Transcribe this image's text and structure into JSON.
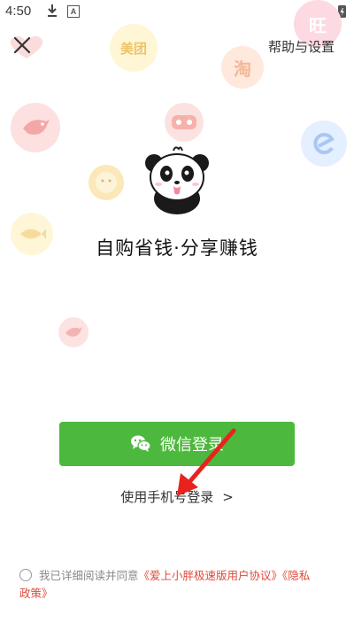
{
  "status_bar": {
    "time": "4:50",
    "a_icon_letter": "A"
  },
  "header": {
    "close_icon": "close-icon",
    "help_label": "帮助与设置"
  },
  "decor": {
    "meituan": "美团",
    "tao": "淘",
    "wang": "旺"
  },
  "main": {
    "slogan": "自购省钱·分享赚钱",
    "wechat_login_label": "微信登录",
    "phone_login_label": "使用手机号登录",
    "phone_login_chevron": ">"
  },
  "agreement": {
    "prefix": "我已详细阅读并同意",
    "user_agreement": "《爱上小胖极速版用户协议》",
    "privacy_policy_part1": "《隐私",
    "privacy_policy_part2": "政策》"
  },
  "colors": {
    "wechat_green": "#4cb83d",
    "link_red": "#e04a3a",
    "annotation_red": "#e8231f"
  }
}
